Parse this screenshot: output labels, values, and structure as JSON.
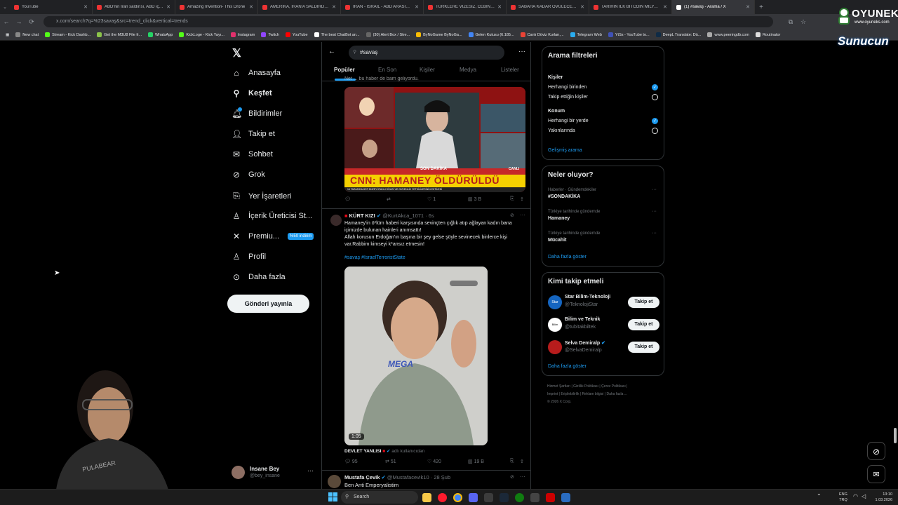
{
  "browser": {
    "tabs": [
      {
        "title": "YouTube",
        "fav": "#ff0000"
      },
      {
        "title": "ABD'nin İran saldırısı, ABD için...",
        "fav": "#ff0000"
      },
      {
        "title": "Amazing Invention- This Drone",
        "fav": "#ff0000"
      },
      {
        "title": "AMERİKA, İRAN'A SALDIRDI | T...",
        "fav": "#ff0000"
      },
      {
        "title": "İRAN - İSRAİL - ABD ARASINDA",
        "fav": "#ff0000"
      },
      {
        "title": "TÜRKLERE VİZESİZ, CEBİNİZİ YO...",
        "fav": "#ff0000"
      },
      {
        "title": "SABAHA KADAR ÖVÜLECEK OY...",
        "fav": "#ff0000"
      },
      {
        "title": "TARİHİN İLK BİTCOİN MİLYARDE...",
        "fav": "#ff0000"
      },
      {
        "title": "(1) #savaş - Arama / X",
        "fav": "#ffffff",
        "active": true
      }
    ],
    "url": "x.com/search?q=%23savaş&src=trend_click&vertical=trends",
    "bookmarks": [
      "New chat",
      "Stream - Kick Dashb...",
      "Get the M3U8 File fr...",
      "WhatsApp",
      "KickLoge - Kick Yayı...",
      "Instagram",
      "Twitch",
      "YouTube",
      "The best ChatBot an...",
      "(30) Alert Box / Stre...",
      "ByNoGame ByNoGa...",
      "Gelen Kutusu (6.185...",
      "Canlı Döviz Kurları,...",
      "Telegram Web",
      "YtSs - YouTube to...",
      "DeepL Translate: Dü...",
      "www.peeringdb.com",
      "Routinator"
    ]
  },
  "overlay": {
    "brand": "OYUNEKS",
    "site": "www.oyuneks.com",
    "sponsor": "Sunucun"
  },
  "nav": {
    "items": [
      "Anasayfa",
      "Keşfet",
      "Bildirimler",
      "Takip et",
      "Sohbet",
      "Grok",
      "Yer İşaretleri",
      "İçerik Üreticisi St...",
      "Premiu...",
      "Profil",
      "Daha fazla"
    ],
    "premium_badge": "%50 indirim",
    "post_button": "Gönderi yayınla",
    "user_name": "Insane Bey",
    "user_handle": "@bey_insane"
  },
  "search": {
    "query": "#savaş",
    "tabs": [
      "Popüler",
      "En Son",
      "Kişiler",
      "Medya",
      "Listeler"
    ]
  },
  "feed": {
    "tweet1": {
      "cut_text": "Net ... bu haber de bam geliyordu.",
      "image_banner_top": "SON DAKİKA",
      "image_banner_main": "CNN: HAMANEY ÖLDÜRÜLDÜ",
      "image_ticker": "14 TARAN'DA ÜST DÜZEY İRANLI SİYASİ VE GÜVENLİK YETKİLİLERİNİN EKTİLEDİ",
      "image_channel": "CANLI",
      "replies": "",
      "reposts": "",
      "likes": "1",
      "views": "3 B"
    },
    "tweet2": {
      "name": "KÜRT KIZI",
      "handle": "@KurtAkca_1071",
      "time": "6s",
      "body": "Hamaney'in ö*lüm haberi karşısında sevinçten çığlık atıp ağlayan kadın bana içimizde bulunan hainleri anımsattı!\nAllah korusun Erdoğan'ın başına bir şey gelse şöyle sevinecek binlerce kişi var.Rabbim kimseyi k*ansız etmesin!",
      "hashtags": "#savaş #IsraelTerroristState",
      "video_duration": "1:05",
      "video_logo": "MEGA",
      "footer_name": "DEVLET YANLISI",
      "footer_sub": "adlı kullanıcıdan",
      "replies": "95",
      "reposts": "51",
      "likes": "420",
      "views": "19 B"
    },
    "tweet3": {
      "name": "Mustafa Çevik",
      "handle": "@Mustafacevik10",
      "time": "28 Şub",
      "body": "Ben Anti Emperyalistim"
    }
  },
  "filters": {
    "title": "Arama filtreleri",
    "people_label": "Kişiler",
    "people_options": [
      "Herhangi birinden",
      "Takip ettiğin kişiler"
    ],
    "location_label": "Konum",
    "location_options": [
      "Herhangi bir yerde",
      "Yakınlarında"
    ],
    "advanced": "Gelişmiş arama"
  },
  "trends": {
    "title": "Neler oluyor?",
    "items": [
      {
        "context": "Haberler · Gündemdekiler",
        "name": "#SONDAKİKA"
      },
      {
        "context": "Türkiye tarihinde gündemde",
        "name": "Hamaney"
      },
      {
        "context": "Türkiye tarihinde gündemde",
        "name": "Mücahit"
      }
    ],
    "more": "Daha fazla göster"
  },
  "who_to_follow": {
    "title": "Kimi takip etmeli",
    "accounts": [
      {
        "name": "Star Bilim-Teknoloji",
        "handle": "@TeknolojiStar",
        "button": "Takip et"
      },
      {
        "name": "Bilim ve Teknik",
        "handle": "@tubitakbiltek",
        "button": "Takip et"
      },
      {
        "name": "Selva Demiralp",
        "handle": "@SelvaDemiralp",
        "button": "Takip et"
      }
    ],
    "more": "Daha fazla göster"
  },
  "footer": {
    "links": [
      "Hizmet Şartları",
      "Gizlilik Politikası",
      "Çerez Politikası",
      "Imprint",
      "Erişilebilirlik",
      "Reklam bilgisi",
      "Daha fazla ..."
    ],
    "copyright": "© 2026 X Corp."
  },
  "taskbar": {
    "search": "Search",
    "lang": "ENG",
    "lang2": "TRQ",
    "time": "13:10",
    "date": "1.03.2026"
  },
  "colors": {
    "accent": "#1d9bf0",
    "bg": "#000000",
    "text": "#e7e9ea",
    "muted": "#71767b"
  }
}
